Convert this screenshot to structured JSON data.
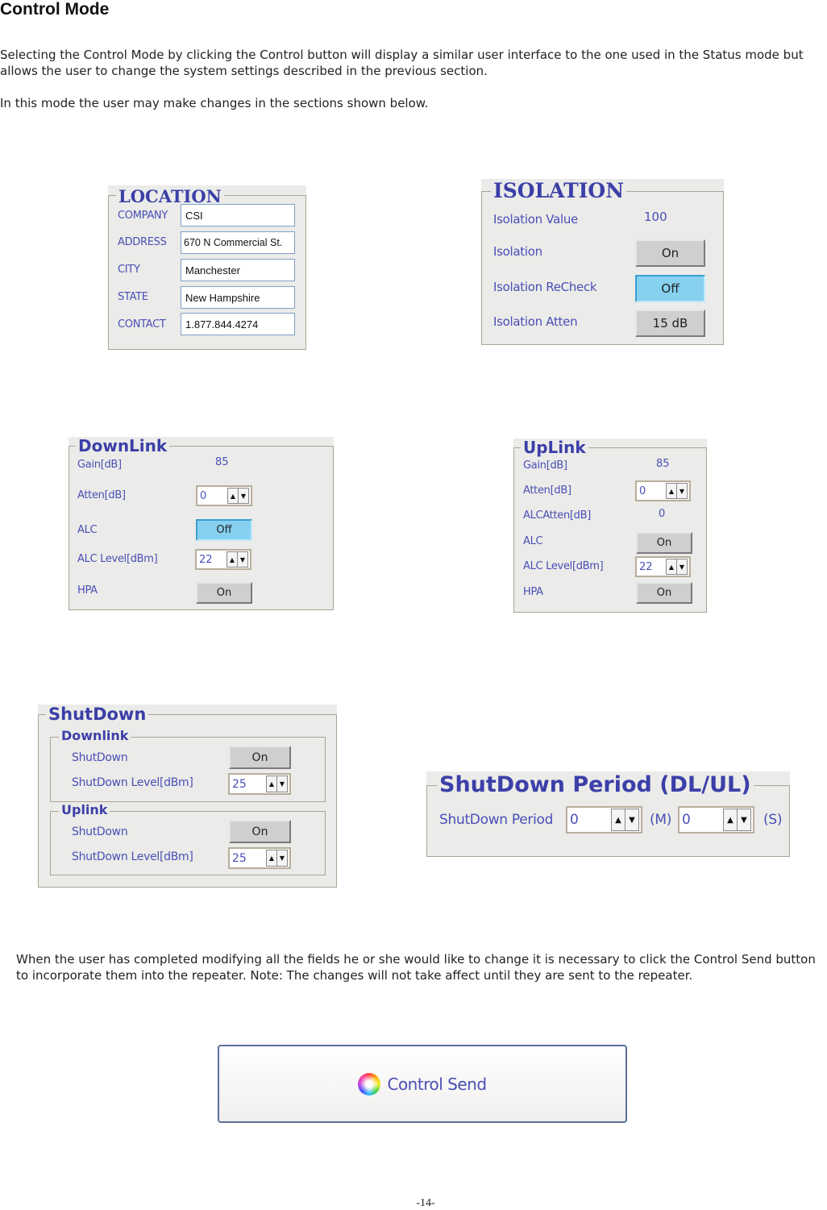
{
  "page": {
    "title": "Control Mode",
    "intro_1": "Selecting the Control Mode by clicking the Control button will display a similar user interface to the one used in the Status mode but allows the user to change the system settings described in the previous section.",
    "intro_2": "In this mode the user may make changes in the sections shown below.",
    "outro": "When the user has completed modifying all the fields he or she would like to change it is necessary to click the Control Send button to incorporate them into the repeater.  Note: The changes will not take affect until they are sent to the repeater.",
    "page_number": "-14-"
  },
  "colors": {
    "label_text": "#4a4fb6",
    "legend_text": "#3b3fa8",
    "panel_bg": "#ebebe9",
    "active_button": "#86d0f0",
    "button_gray": "#cfcfcf"
  },
  "location": {
    "title": "LOCATION",
    "fields": [
      {
        "label": "COMPANY",
        "value": "CSI"
      },
      {
        "label": "ADDRESS",
        "value": "670 N Commercial St."
      },
      {
        "label": "CITY",
        "value": "Manchester"
      },
      {
        "label": "STATE",
        "value": "New Hampshire"
      },
      {
        "label": "CONTACT",
        "value": "1.877.844.4274"
      }
    ]
  },
  "isolation": {
    "title": "ISOLATION",
    "value_label": "Isolation Value",
    "value": "100",
    "isolation_label": "Isolation",
    "isolation_button": "On",
    "recheck_label": "Isolation ReCheck",
    "recheck_button": "Off",
    "atten_label": "Isolation Atten",
    "atten_button": "15 dB"
  },
  "downlink": {
    "title": "DownLink",
    "gain_label": "Gain[dB]",
    "gain_value": "85",
    "atten_label": "Atten[dB]",
    "atten_value": "0",
    "alc_label": "ALC",
    "alc_button": "Off",
    "alc_level_label": "ALC Level[dBm]",
    "alc_level_value": "22",
    "hpa_label": "HPA",
    "hpa_button": "On"
  },
  "uplink": {
    "title": "UpLink",
    "gain_label": "Gain[dB]",
    "gain_value": "85",
    "atten_label": "Atten[dB]",
    "atten_value": "0",
    "alcatten_label": "ALCAtten[dB]",
    "alcatten_value": "0",
    "alc_label": "ALC",
    "alc_button": "On",
    "alc_level_label": "ALC Level[dBm]",
    "alc_level_value": "22",
    "hpa_label": "HPA",
    "hpa_button": "On"
  },
  "shutdown": {
    "title": "ShutDown",
    "downlink": {
      "title": "Downlink",
      "shutdown_label": "ShutDown",
      "shutdown_button": "On",
      "level_label": "ShutDown Level[dBm]",
      "level_value": "25"
    },
    "uplink": {
      "title": "Uplink",
      "shutdown_label": "ShutDown",
      "shutdown_button": "On",
      "level_label": "ShutDown Level[dBm]",
      "level_value": "25"
    }
  },
  "shutdown_period": {
    "title": "ShutDown Period (DL/UL)",
    "label": "ShutDown Period",
    "minutes_value": "0",
    "minutes_unit": "(M)",
    "seconds_value": "0",
    "seconds_unit": "(S)"
  },
  "control_send": {
    "label": "Control Send",
    "icon": "color-wheel-icon"
  },
  "spinner": {
    "up_glyph": "▲",
    "down_glyph": "▼"
  }
}
